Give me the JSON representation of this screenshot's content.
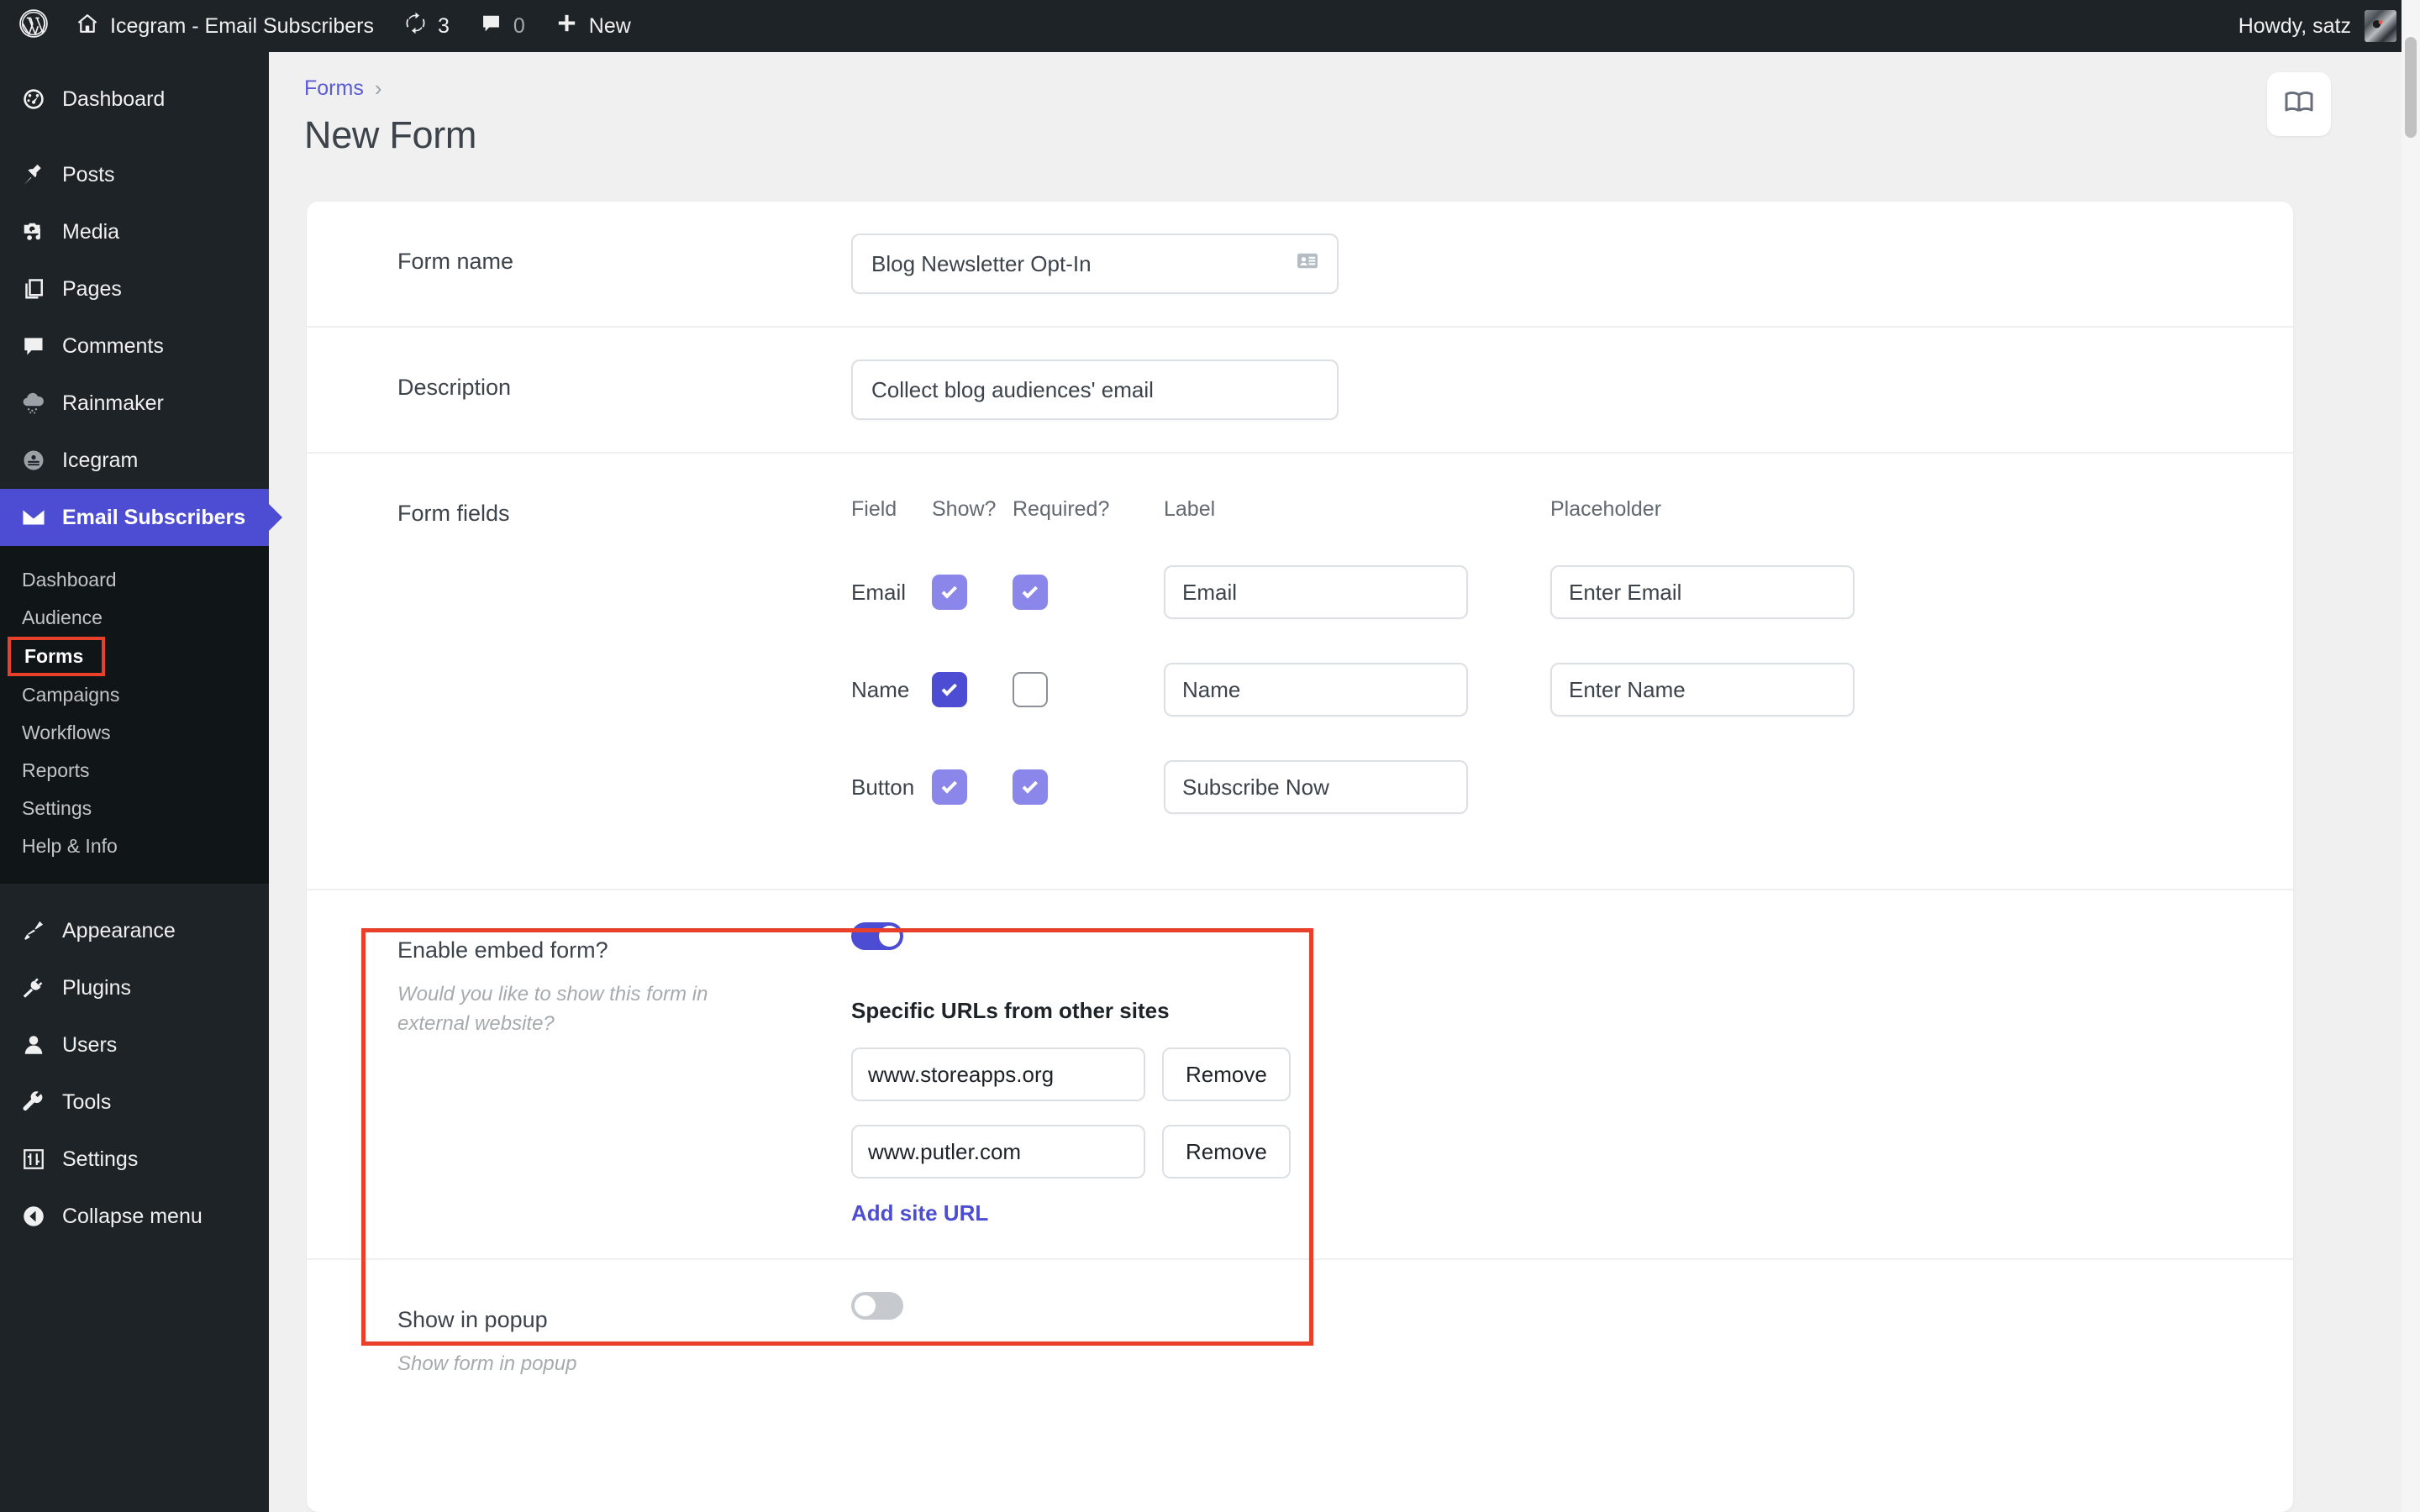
{
  "adminbar": {
    "site_name": "Icegram - Email Subscribers",
    "updates_count": "3",
    "comments_count": "0",
    "new_label": "New",
    "howdy": "Howdy, satz",
    "icons": {
      "wp_logo": "wordpress-logo-icon",
      "home": "home-icon",
      "updates": "updates-refresh-icon",
      "comments": "comment-bubble-icon",
      "new": "plus-icon",
      "avatar": "user-avatar"
    }
  },
  "sidebar": {
    "items": [
      {
        "label": "Dashboard",
        "icon": "dashboard-gauge-icon",
        "current": false
      },
      {
        "label": "Posts",
        "icon": "pin-icon",
        "current": false
      },
      {
        "label": "Media",
        "icon": "media-camera-music-icon",
        "current": false
      },
      {
        "label": "Pages",
        "icon": "pages-stack-icon",
        "current": false
      },
      {
        "label": "Comments",
        "icon": "comment-bubble-icon",
        "current": false
      },
      {
        "label": "Rainmaker",
        "icon": "rain-cloud-icon",
        "current": false
      },
      {
        "label": "Icegram",
        "icon": "icegram-circle-icon",
        "current": false
      },
      {
        "label": "Email Subscribers",
        "icon": "envelope-icon",
        "current": true
      }
    ],
    "submenu": [
      {
        "label": "Dashboard",
        "current": false,
        "highlighted": false
      },
      {
        "label": "Audience",
        "current": false,
        "highlighted": false
      },
      {
        "label": "Forms",
        "current": true,
        "highlighted": true
      },
      {
        "label": "Campaigns",
        "current": false,
        "highlighted": false
      },
      {
        "label": "Workflows",
        "current": false,
        "highlighted": false
      },
      {
        "label": "Reports",
        "current": false,
        "highlighted": false
      },
      {
        "label": "Settings",
        "current": false,
        "highlighted": false
      },
      {
        "label": "Help & Info",
        "current": false,
        "highlighted": false
      }
    ],
    "items_bottom": [
      {
        "label": "Appearance",
        "icon": "paint-brush-icon"
      },
      {
        "label": "Plugins",
        "icon": "plug-icon"
      },
      {
        "label": "Users",
        "icon": "user-icon"
      },
      {
        "label": "Tools",
        "icon": "wrench-icon"
      },
      {
        "label": "Settings",
        "icon": "sliders-icon"
      },
      {
        "label": "Collapse menu",
        "icon": "collapse-arrow-left-icon"
      }
    ]
  },
  "page": {
    "breadcrumb_parent": "Forms",
    "breadcrumb_separator": "›",
    "title": "New Form",
    "doc_icon": "open-book-icon"
  },
  "form": {
    "form_name": {
      "label": "Form name",
      "value": "Blog Newsletter Opt-In",
      "icon": "contact-card-icon"
    },
    "description": {
      "label": "Description",
      "value": "Collect blog audiences' email"
    },
    "form_fields": {
      "label": "Form fields",
      "columns": [
        "Field",
        "Show?",
        "Required?",
        "Label",
        "Placeholder"
      ],
      "rows": [
        {
          "field": "Email",
          "show": true,
          "show_state": "locked",
          "required": true,
          "required_state": "locked",
          "label_value": "Email",
          "placeholder_value": "Enter Email",
          "has_placeholder": true
        },
        {
          "field": "Name",
          "show": true,
          "show_state": "active",
          "required": false,
          "required_state": "unchecked",
          "label_value": "Name",
          "placeholder_value": "Enter Name",
          "has_placeholder": true
        },
        {
          "field": "Button",
          "show": true,
          "show_state": "locked",
          "required": true,
          "required_state": "locked",
          "label_value": "Subscribe Now",
          "placeholder_value": "",
          "has_placeholder": false
        }
      ]
    },
    "embed": {
      "label": "Enable embed form?",
      "hint": "Would you like to show this form in external website?",
      "enabled": true,
      "urls_heading": "Specific URLs from other sites",
      "urls": [
        {
          "value": "www.storeapps.org",
          "remove_label": "Remove"
        },
        {
          "value": "www.putler.com",
          "remove_label": "Remove"
        }
      ],
      "add_link": "Add site URL"
    },
    "popup": {
      "label": "Show in popup",
      "hint": "Show form in popup",
      "enabled": false
    }
  },
  "colors": {
    "accent": "#4d4dd4",
    "accent_light": "#8b87ea",
    "annotation": "#e8402a",
    "admin_bg": "#1d2327",
    "page_bg": "#f0f0f1"
  }
}
